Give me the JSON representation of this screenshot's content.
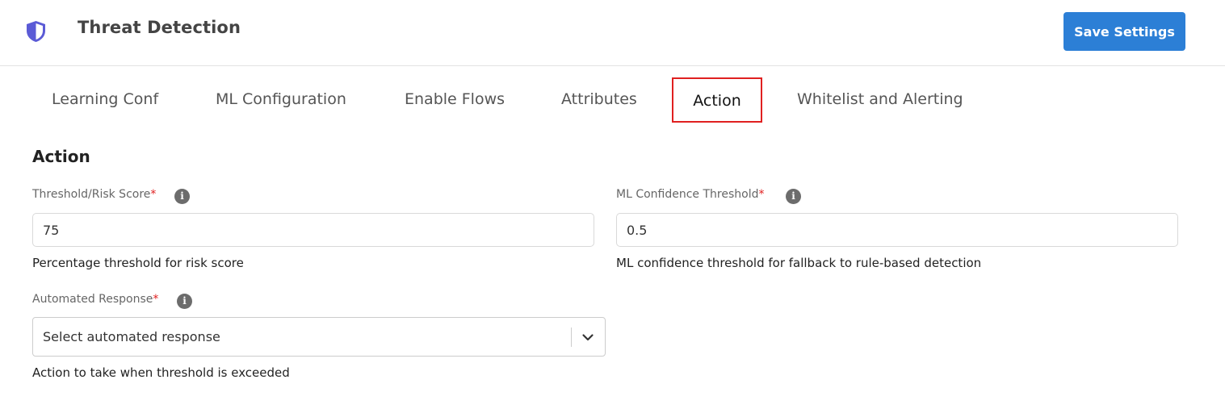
{
  "header": {
    "title": "Threat Detection",
    "icon": "shield-icon",
    "save_label": "Save Settings"
  },
  "tabs": [
    {
      "label": "Learning Conf"
    },
    {
      "label": "ML Configuration"
    },
    {
      "label": "Enable Flows"
    },
    {
      "label": "Attributes"
    },
    {
      "label": "Action",
      "active": true
    },
    {
      "label": "Whitelist and Alerting"
    }
  ],
  "section": {
    "title": "Action"
  },
  "fields": {
    "threshold": {
      "label": "Threshold/Risk Score",
      "required": "*",
      "value": "75",
      "help": "Percentage threshold for risk score"
    },
    "ml_confidence": {
      "label": "ML Confidence Threshold",
      "required": "*",
      "value": "0.5",
      "help": "ML confidence threshold for fallback to rule-based detection"
    },
    "automated_response": {
      "label": "Automated Response",
      "required": "*",
      "placeholder": "Select automated response",
      "help": "Action to take when threshold is exceeded"
    }
  },
  "info_icon_glyph": "i",
  "colors": {
    "primary": "#2c7fd6",
    "required": "#e02020",
    "active_tab_border": "#e02020",
    "shield": "#5b5bd6"
  }
}
